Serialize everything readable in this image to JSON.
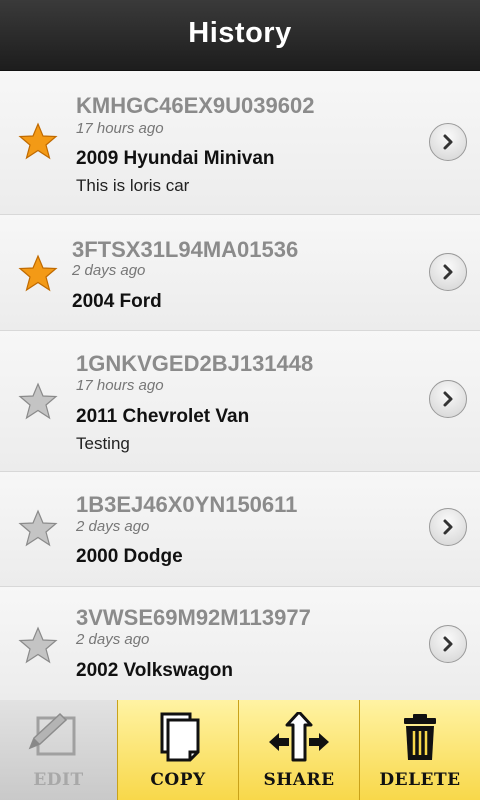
{
  "header": {
    "title": "History"
  },
  "history": [
    {
      "vin": "KMHGC46EX9U039602",
      "time": "17 hours ago",
      "vehicle": "2009 Hyundai Minivan",
      "note": "This is loris car",
      "favorite": true
    },
    {
      "vin": "3FTSX31L94MA01536",
      "time": "2 days ago",
      "vehicle": "2004 Ford",
      "note": "",
      "favorite": true
    },
    {
      "vin": "1GNKVGED2BJ131448",
      "time": "17 hours ago",
      "vehicle": "2011 Chevrolet Van",
      "note": "Testing",
      "favorite": false
    },
    {
      "vin": "1B3EJ46X0YN150611",
      "time": "2 days ago",
      "vehicle": "2000 Dodge",
      "note": "",
      "favorite": false
    },
    {
      "vin": "3VWSE69M92M113977",
      "time": "2 days ago",
      "vehicle": "2002 Volkswagon",
      "note": "",
      "favorite": false
    }
  ],
  "toolbar": {
    "edit": {
      "label": "EDIT",
      "icon": "edit-icon",
      "enabled": false
    },
    "copy": {
      "label": "COPY",
      "icon": "copy-icon",
      "enabled": true
    },
    "share": {
      "label": "SHARE",
      "icon": "share-icon",
      "enabled": true
    },
    "delete": {
      "label": "DELETE",
      "icon": "trash-icon",
      "enabled": true
    }
  },
  "colors": {
    "star_on": "#f39a16",
    "star_off": "#a6a6a6",
    "toolbar_active": "#f8d84a"
  }
}
